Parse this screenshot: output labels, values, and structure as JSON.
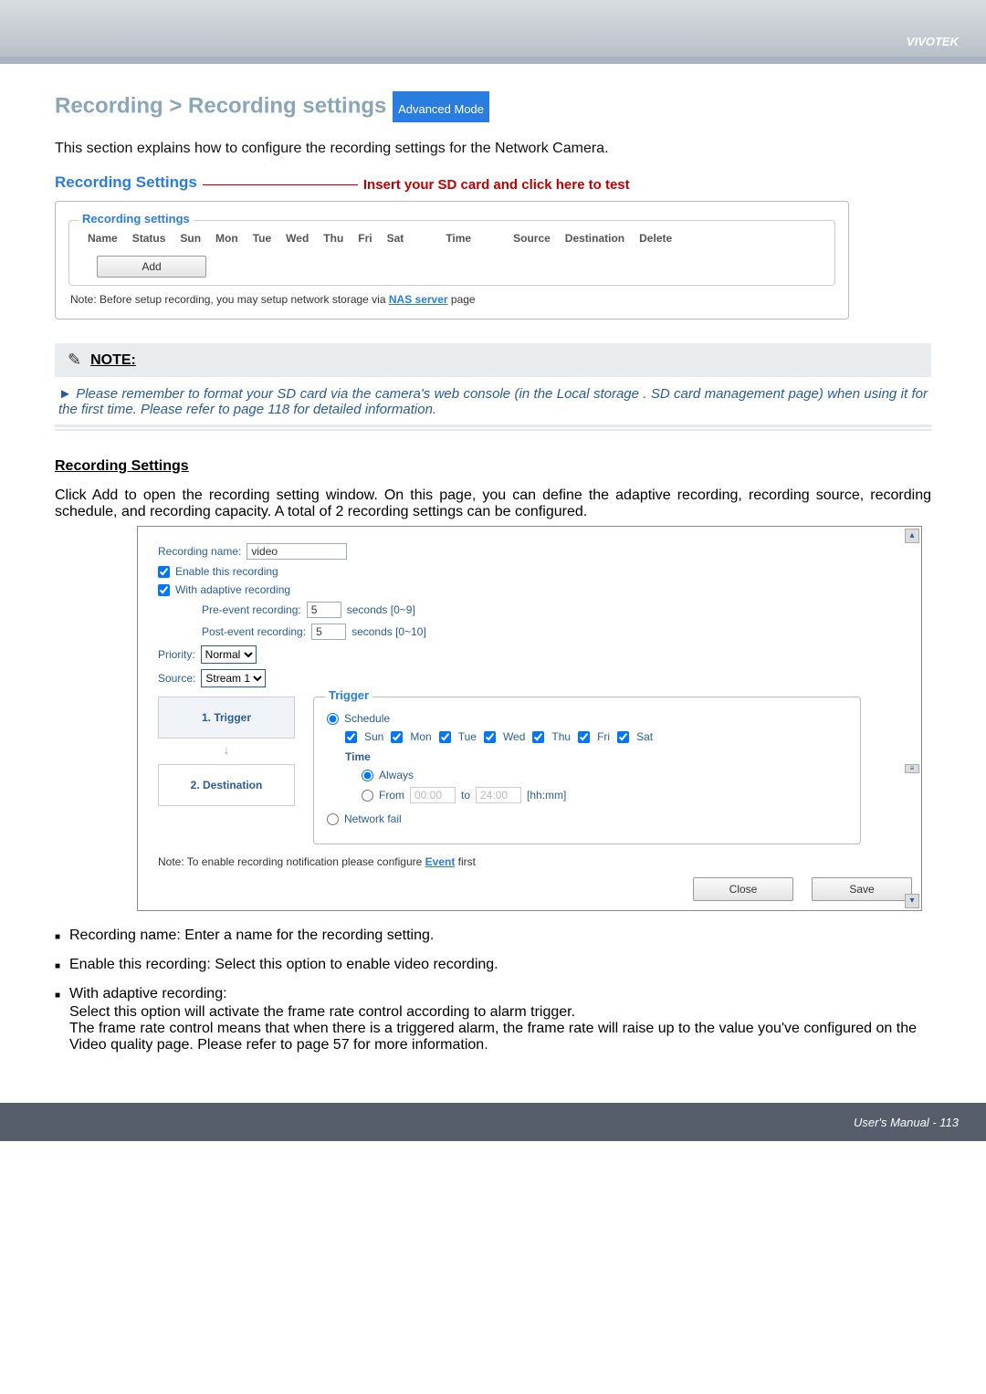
{
  "brand": "VIVOTEK",
  "page_title_prefix": "Recording > Recording settings",
  "adv_mode": "Advanced Mode",
  "intro": "This section explains how to configure the recording settings for the Network Camera.",
  "section_heading": "Recording Settings",
  "insert_hint": "Insert your SD card and click here to test",
  "fieldset_legend": "Recording settings",
  "table_headers": [
    "Name",
    "Status",
    "Sun",
    "Mon",
    "Tue",
    "Wed",
    "Thu",
    "Fri",
    "Sat",
    "Time",
    "Source",
    "Destination",
    "Delete"
  ],
  "add_button": "Add",
  "panel_note_prefix": "Note: Before setup recording, you may setup network storage via ",
  "panel_note_link": "NAS server",
  "panel_note_suffix": " page",
  "note_icon": "✎",
  "note_label": "NOTE:",
  "note_body": "► Please remember to format your SD card via the camera's web console (in the Local storage . SD card management page) when using it for the first time. Please refer to page 118 for detailed information.",
  "subhead": "Recording Settings",
  "body_para": "Click Add to open the recording setting window. On this page, you can define the adaptive recording, recording source, recording schedule, and recording capacity. A total of 2 recording settings can be configured.",
  "dialog": {
    "recording_name_label": "Recording name:",
    "recording_name_value": "video",
    "enable_label": "Enable this recording",
    "adaptive_label": "With adaptive recording",
    "pre_label": "Pre-event recording:",
    "pre_value": "5",
    "pre_hint": "seconds [0~9]",
    "post_label": "Post-event recording:",
    "post_value": "5",
    "post_hint": "seconds [0~10]",
    "priority_label": "Priority:",
    "priority_value": "Normal",
    "source_label": "Source:",
    "source_value": "Stream 1",
    "step1": "1. Trigger",
    "step2": "2. Destination",
    "trigger_legend": "Trigger",
    "schedule_label": "Schedule",
    "days": [
      "Sun",
      "Mon",
      "Tue",
      "Wed",
      "Thu",
      "Fri",
      "Sat"
    ],
    "time_heading": "Time",
    "always_label": "Always",
    "from_label": "From",
    "from_value": "00:00",
    "to_label": "to",
    "to_value": "24:00",
    "hhmm": "[hh:mm]",
    "network_fail_label": "Network fail",
    "dlg_note_prefix": "Note: To enable recording notification please configure ",
    "dlg_note_link": "Event",
    "dlg_note_suffix": " first",
    "close": "Close",
    "save": "Save"
  },
  "bullets": {
    "b1": "Recording name: Enter a name for the recording setting.",
    "b2": "Enable this recording: Select this option to enable video recording.",
    "b3_head": "With adaptive recording:",
    "b3_p1": "Select this option will activate the frame rate control according to alarm trigger.",
    "b3_p2": "The frame rate control means that when there is a triggered alarm, the frame rate will raise up to the value you've configured on the Video quality page. Please refer to page 57 for more information."
  },
  "footer": "User's Manual - 113"
}
